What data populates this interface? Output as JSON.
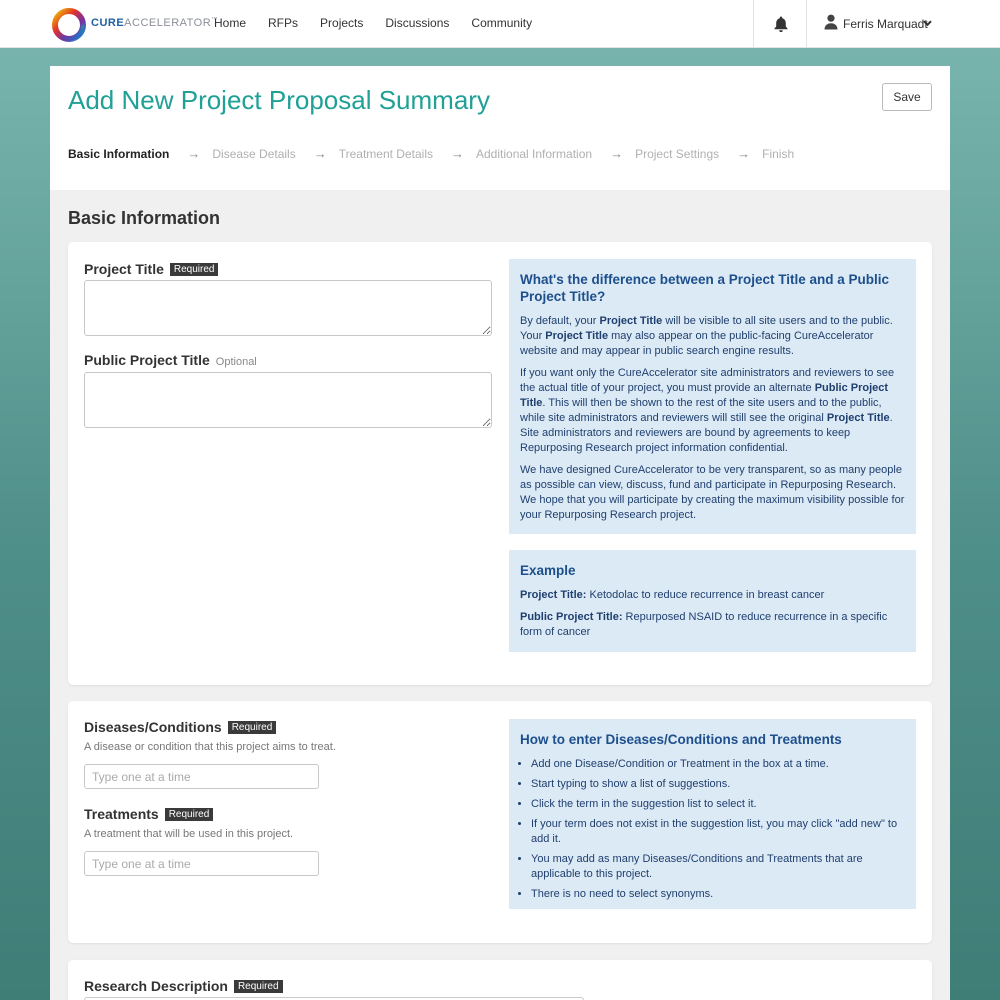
{
  "nav": {
    "brand_bold": "CURE",
    "brand_light": "ACCELERATOR",
    "brand_tm": "™",
    "links": [
      "Home",
      "RFPs",
      "Projects",
      "Discussions",
      "Community"
    ],
    "user_name": "Ferris Marquadt"
  },
  "header": {
    "title": "Add New Project Proposal Summary",
    "save_label": "Save",
    "steps": [
      "Basic Information",
      "Disease Details",
      "Treatment Details",
      "Additional Information",
      "Project Settings",
      "Finish"
    ],
    "active_step": 0,
    "step_arrow": "→"
  },
  "section_heading": "Basic Information",
  "card1": {
    "project_title": {
      "label": "Project Title",
      "badge": "Required",
      "value": ""
    },
    "public_title": {
      "label": "Public Project Title",
      "badge": "Optional",
      "value": ""
    },
    "info": {
      "heading": "What's the difference between a Project Title and a Public Project Title?",
      "p1": [
        "By default, your ",
        "Project Title",
        " will be visible to all site users and to the public. Your ",
        "Project Title",
        " may also appear on the public-facing CureAccelerator website and may appear in public search engine results."
      ],
      "p2": [
        "If you want only the CureAccelerator site administrators and reviewers to see the actual title of your project, you must provide an alternate ",
        "Public Project Title",
        ". This will then be shown to the rest of the site users and to the public, while site administrators and reviewers will still see the original ",
        "Project Title",
        ". Site administrators and reviewers are bound by agreements to keep Repurposing Research project information confidential."
      ],
      "p3": "We have designed CureAccelerator to be very transparent, so as many people as possible can view, discuss, fund and participate in Repurposing Research. We hope that you will participate by creating the maximum visibility possible for your Repurposing Research project."
    },
    "example": {
      "heading": "Example",
      "line1_label": "Project Title:",
      "line1_text": " Ketodolac to reduce recurrence in breast cancer",
      "line2_label": "Public Project Title:",
      "line2_text": " Repurposed NSAID to reduce recurrence in a specific form of cancer"
    }
  },
  "card2": {
    "diseases": {
      "label": "Diseases/Conditions",
      "badge": "Required",
      "help": "A disease or condition that this project aims to treat.",
      "placeholder": "Type one at a time"
    },
    "treatments": {
      "label": "Treatments",
      "badge": "Required",
      "help": "A treatment that will be used in this project.",
      "placeholder": "Type one at a time"
    },
    "info": {
      "heading": "How to enter Diseases/Conditions and Treatments",
      "items": [
        "Add one Disease/Condition or Treatment in the box at a time.",
        "Start typing to show a list of suggestions.",
        "Click the term in the suggestion list to select it.",
        "If your term does not exist in the suggestion list, you may click \"add new\" to add it.",
        "You may add as many Diseases/Conditions and Treatments that are applicable to this project.",
        "There is no need to select synonyms."
      ]
    }
  },
  "card3": {
    "research_description": {
      "label": "Research Description",
      "badge": "Required"
    }
  },
  "colors": {
    "accent_teal": "#21a096",
    "info_bg": "#dceaf6",
    "info_heading": "#1d4f8c",
    "brand_blue": "#1f5fa6"
  },
  "icons": {
    "logo": "logo-ring-icon",
    "bell": "bell-icon",
    "user": "user-icon",
    "chevron": "chevron-down-icon"
  }
}
